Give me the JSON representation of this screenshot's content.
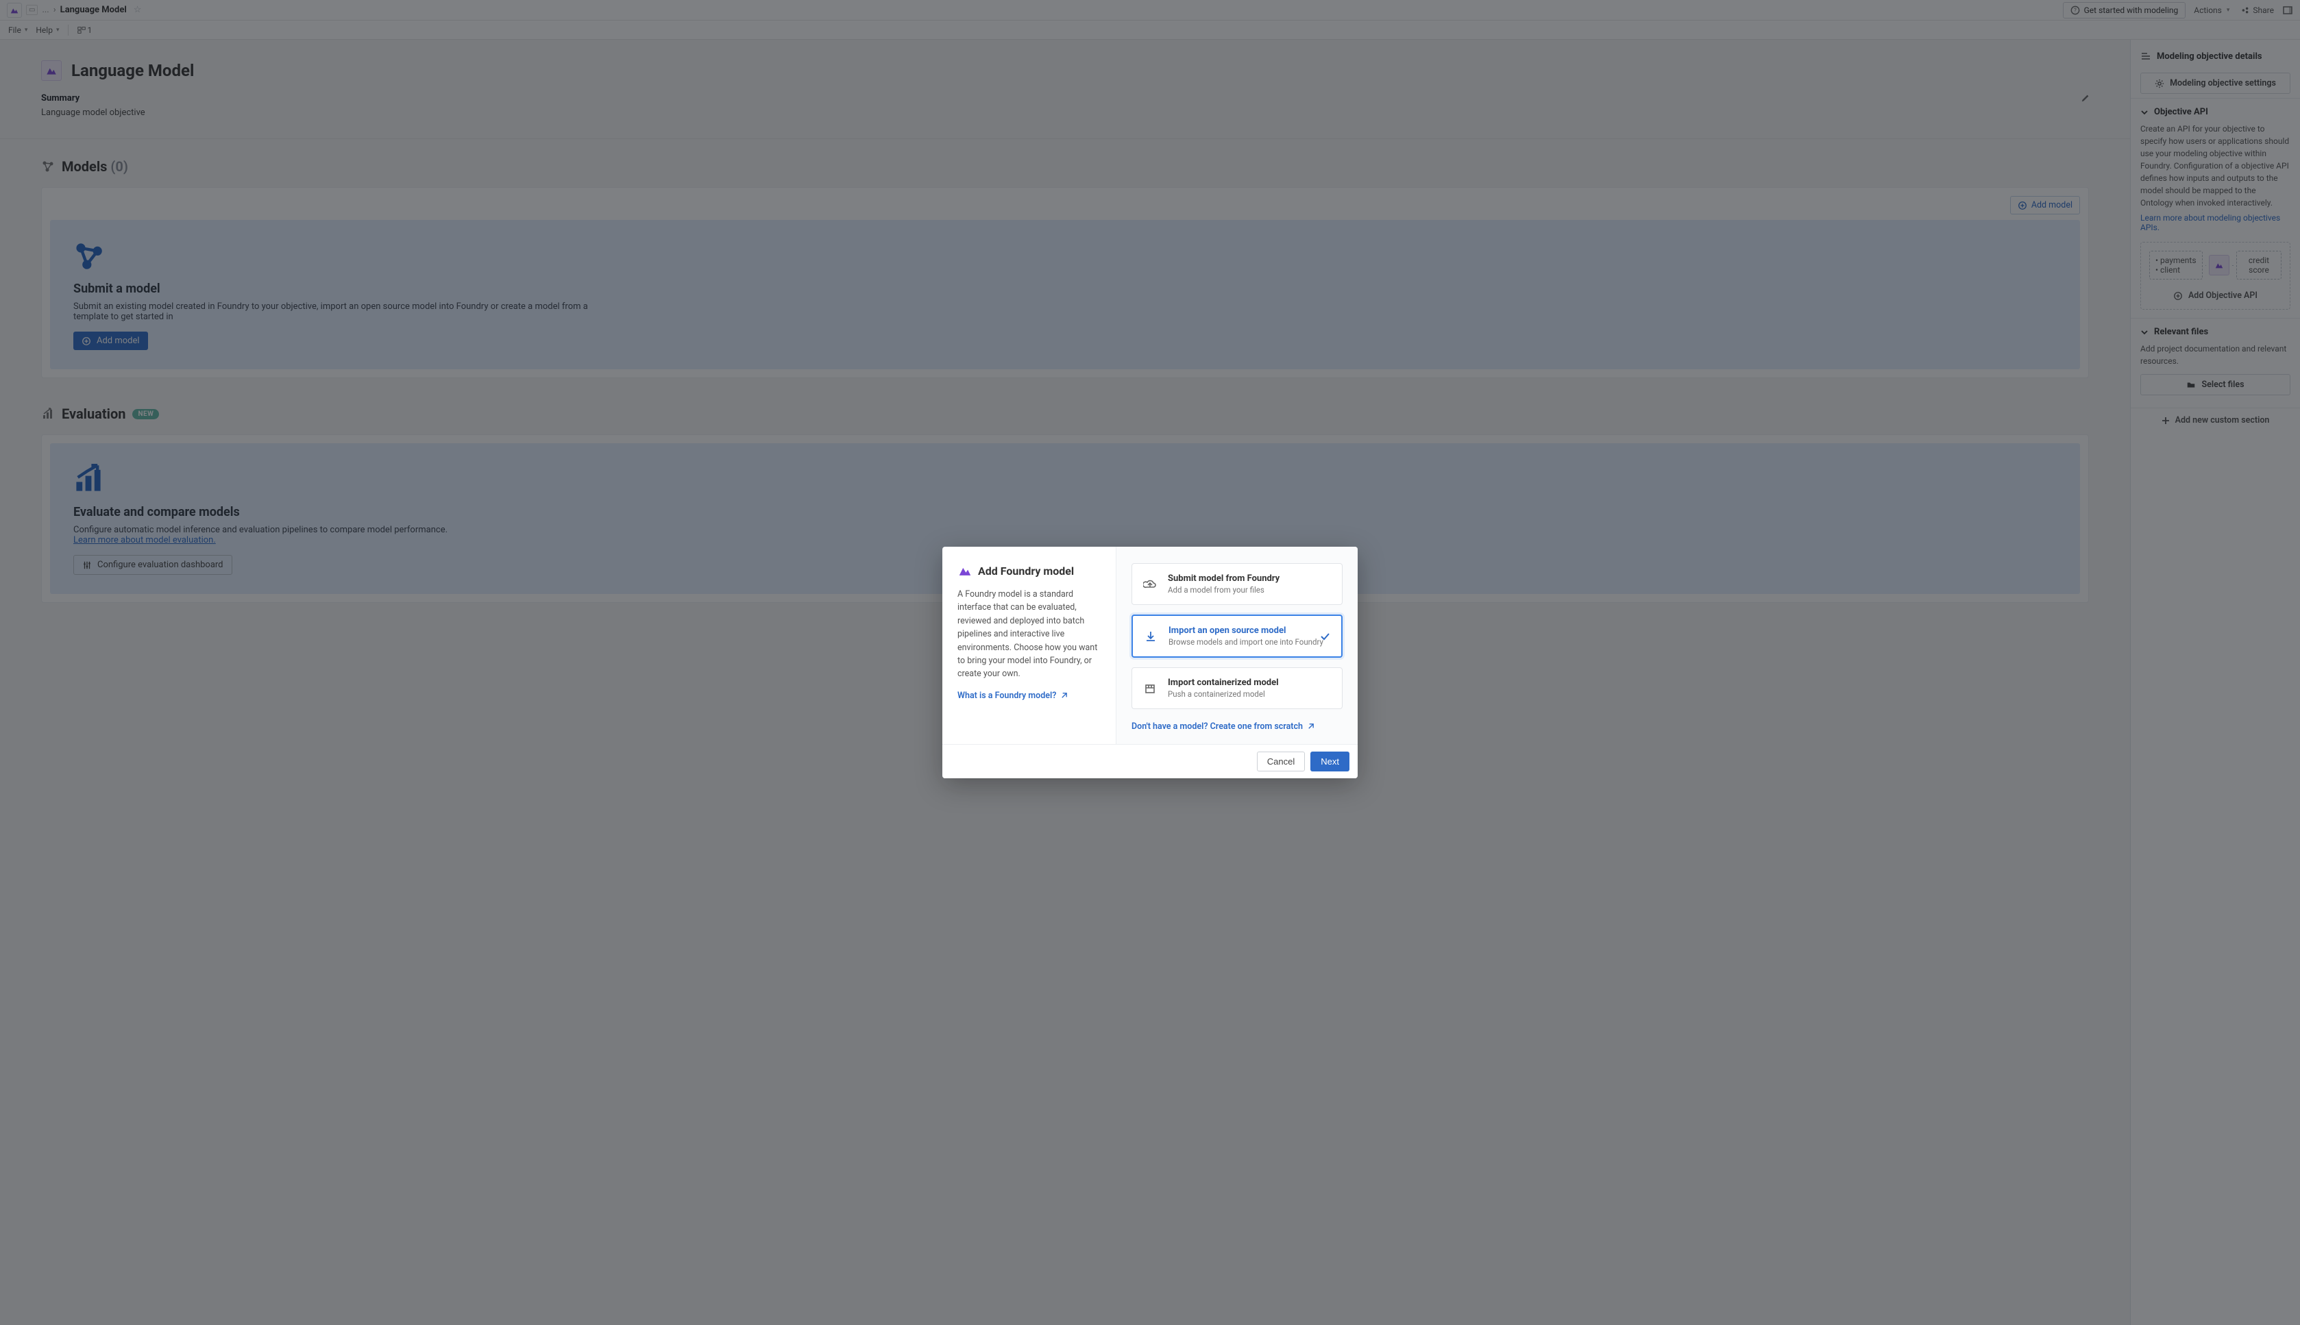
{
  "topbar": {
    "breadcrumb_root": "...",
    "breadcrumb_sep": "›",
    "breadcrumb_current": "Language Model",
    "get_started": "Get started with modeling",
    "actions": "Actions",
    "share": "Share"
  },
  "menu": {
    "file": "File",
    "help": "Help",
    "views_count": "1"
  },
  "page": {
    "title": "Language Model",
    "summary_label": "Summary",
    "summary_text": "Language model objective"
  },
  "models_section": {
    "title": "Models",
    "count": "(0)",
    "add_btn": "Add model",
    "card_title": "Submit a model",
    "card_desc": "Submit an existing model created in Foundry to your objective, import an open source model into Foundry or create a model from a template to get started in",
    "card_btn": "Add model"
  },
  "eval_section": {
    "title": "Evaluation",
    "badge": "NEW",
    "card_title": "Evaluate and compare models",
    "card_desc": "Configure automatic model inference and evaluation pipelines to compare model performance.",
    "card_link": "Learn more about model evaluation.",
    "card_btn": "Configure evaluation dashboard"
  },
  "right_panel": {
    "details_title": "Modeling objective details",
    "settings_btn": "Modeling objective settings",
    "objective_api_title": "Objective API",
    "objective_api_desc": "Create an API for your objective to specify how users or applications should use your modeling objective within Foundry. Configuration of a objective API defines how inputs and outputs to the model should be mapped to the Ontology when invoked interactively.",
    "objective_api_link": "Learn more about modeling objectives APIs.",
    "api_inputs_1": "payments",
    "api_inputs_2": "client",
    "api_output_1": "credit",
    "api_output_2": "score",
    "add_api_btn": "Add Objective API",
    "relevant_files_title": "Relevant files",
    "relevant_files_desc": "Add project documentation and relevant resources.",
    "select_files_btn": "Select files",
    "add_custom_section": "Add new custom section"
  },
  "modal": {
    "title": "Add Foundry model",
    "desc": "A Foundry model is a standard interface that can be evaluated, reviewed and deployed into batch pipelines and interactive live environments. Choose how you want to bring your model into Foundry, or create your own.",
    "help_link": "What is a Foundry model?",
    "options": [
      {
        "title": "Submit model from Foundry",
        "sub": "Add a model from your files"
      },
      {
        "title": "Import an open source model",
        "sub": "Browse models and import one into Foundry"
      },
      {
        "title": "Import containerized model",
        "sub": "Push a containerized model"
      }
    ],
    "scratch_link": "Don't have a model? Create one from scratch",
    "cancel": "Cancel",
    "next": "Next"
  }
}
